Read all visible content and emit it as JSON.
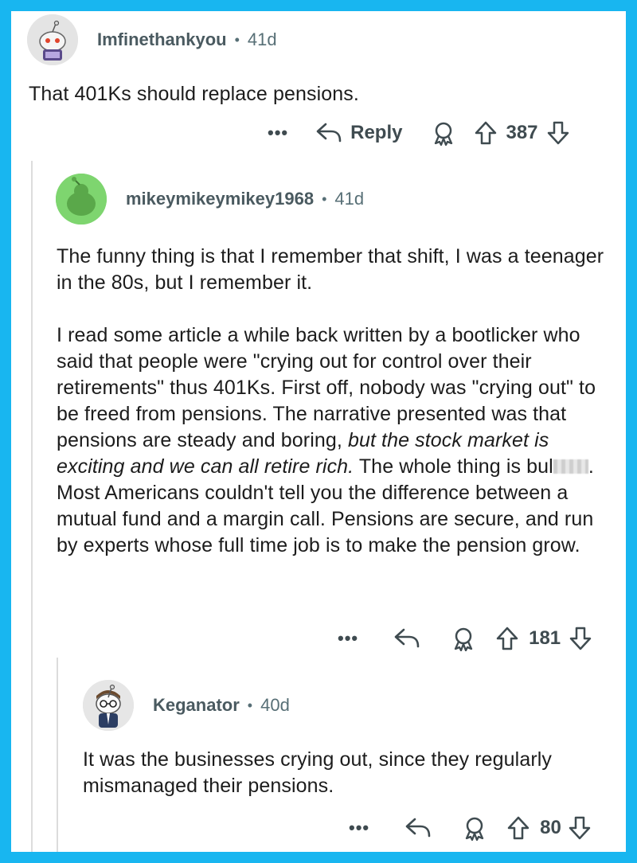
{
  "comments": [
    {
      "username": "Imfinethankyou",
      "age": "41d",
      "body": [
        "That 401Ks should replace pensions."
      ],
      "more_label": "•••",
      "reply_label": "Reply",
      "score": "387"
    },
    {
      "username": "mikeymikeymikey1968",
      "age": "41d",
      "para1": "The funny thing is that I remember that shift, I was a teenager in the 80s, but I remember it.",
      "para2_a": "I read some article a while back written by a bootlicker who said that people were \"crying out for control over their retirements\" thus 401Ks.  First off, nobody was \"crying out\" to be freed from pensions. The narrative presented was that pensions are steady and boring, ",
      "para2_italic": "but the stock market is exciting and we can all retire rich.",
      "para2_b": " The whole thing is bul",
      "para2_c": ". Most Americans couldn't tell you the difference between a mutual fund and a margin call.  Pensions are secure, and run by experts whose full time job is to make the pension grow.",
      "more_label": "•••",
      "score": "181"
    },
    {
      "username": "Keganator",
      "age": "40d",
      "body": [
        "It was the businesses crying out, since they regularly mismanaged their pensions."
      ],
      "more_label": "•••",
      "score": "80"
    }
  ],
  "separator": "•",
  "icons": [
    "more-icon",
    "reply-icon",
    "award-icon",
    "upvote-icon",
    "downvote-icon",
    "avatar"
  ],
  "colors": {
    "background": "#18b6f0",
    "text": "#1c1c1c",
    "meta": "#576f76"
  }
}
